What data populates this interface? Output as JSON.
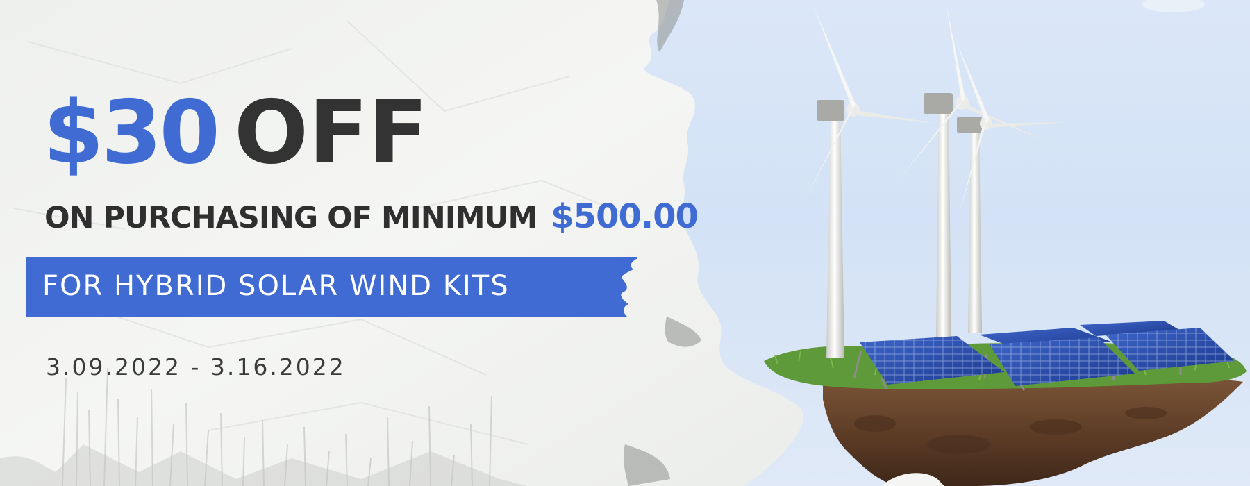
{
  "promo": {
    "discount_amount": "$30",
    "discount_word": "OFF",
    "condition_text": "ON PURCHASING OF MINIMUM",
    "minimum_amount": "$500.00",
    "banner_text": "FOR HYBRID SOLAR WIND KITS",
    "date_range": "3.09.2022 - 3.16.2022"
  },
  "colors": {
    "accent_blue": "#3f6bd3",
    "dark_text": "#333333",
    "paper": "#f2f3f1",
    "sky": "#d6e4f7"
  },
  "illustration": {
    "subject": "wind turbines and solar panels on floating earth island"
  }
}
